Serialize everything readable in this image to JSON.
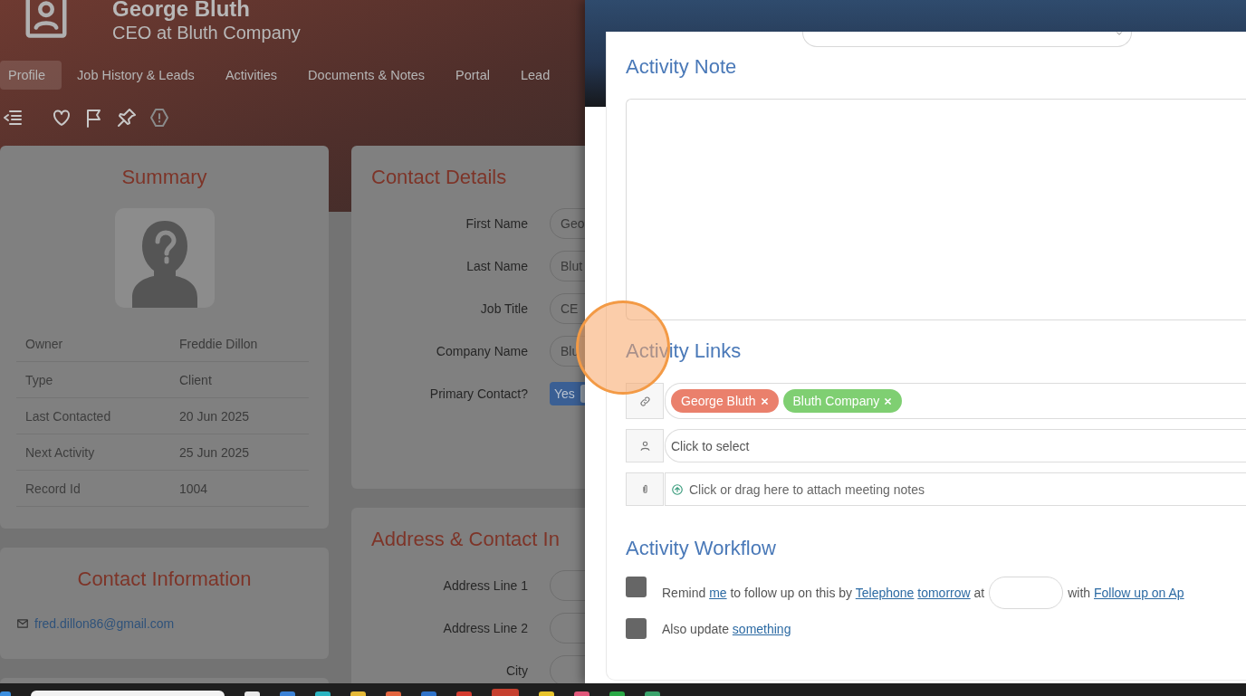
{
  "header": {
    "title": "George Bluth",
    "subtitle": "CEO at Bluth Company"
  },
  "tabs": [
    {
      "label": "Profile",
      "selected": true
    },
    {
      "label": "Job History & Leads",
      "selected": false
    },
    {
      "label": "Activities",
      "selected": false
    },
    {
      "label": "Documents & Notes",
      "selected": false
    },
    {
      "label": "Portal",
      "selected": false
    },
    {
      "label": "Lead",
      "selected": false
    }
  ],
  "summary": {
    "title": "Summary",
    "rows": [
      {
        "label": "Owner",
        "value": "Freddie Dillon"
      },
      {
        "label": "Type",
        "value": "Client"
      },
      {
        "label": "Last Contacted",
        "value": "20 Jun 2025"
      },
      {
        "label": "Next Activity",
        "value": "25 Jun 2025"
      },
      {
        "label": "Record Id",
        "value": "1004"
      }
    ]
  },
  "contact_information": {
    "title": "Contact Information",
    "email": "fred.dillon86@gmail.com"
  },
  "contact_details": {
    "title": "Contact Details",
    "fields": [
      {
        "label": "First Name",
        "value": "Geo"
      },
      {
        "label": "Last Name",
        "value": "Blut"
      },
      {
        "label": "Job Title",
        "value": "CE"
      },
      {
        "label": "Company Name",
        "value": "Blu"
      }
    ],
    "primary": {
      "label": "Primary Contact?",
      "value": "Yes",
      "on": true
    }
  },
  "address": {
    "title": "Address & Contact In",
    "fields": [
      {
        "label": "Address Line 1"
      },
      {
        "label": "Address Line 2"
      },
      {
        "label": "City"
      }
    ]
  },
  "activity_panel": {
    "note_title": "Activity Note",
    "links_title": "Activity Links",
    "tags": [
      {
        "label": "George Bluth",
        "color": "#ea806c"
      },
      {
        "label": "Bluth Company",
        "color": "#7fcf72"
      }
    ],
    "person_placeholder": "Click to select",
    "attach_text": "Click or drag here to attach meeting notes",
    "workflow_title": "Activity Workflow",
    "workflow": [
      {
        "checked": false,
        "parts": [
          {
            "kind": "text",
            "text": "Remind"
          },
          {
            "kind": "link",
            "text": "me"
          },
          {
            "kind": "text",
            "text": "to follow up on this by"
          },
          {
            "kind": "link",
            "text": "Telephone"
          },
          {
            "kind": "link",
            "text": "tomorrow"
          },
          {
            "kind": "text",
            "text": "at"
          },
          {
            "kind": "time_field"
          },
          {
            "kind": "text",
            "text": "with"
          },
          {
            "kind": "link",
            "text": "Follow up on Ap"
          }
        ]
      },
      {
        "checked": false,
        "parts": [
          {
            "kind": "text",
            "text": "Also update"
          },
          {
            "kind": "link",
            "text": "something"
          }
        ]
      }
    ]
  }
}
